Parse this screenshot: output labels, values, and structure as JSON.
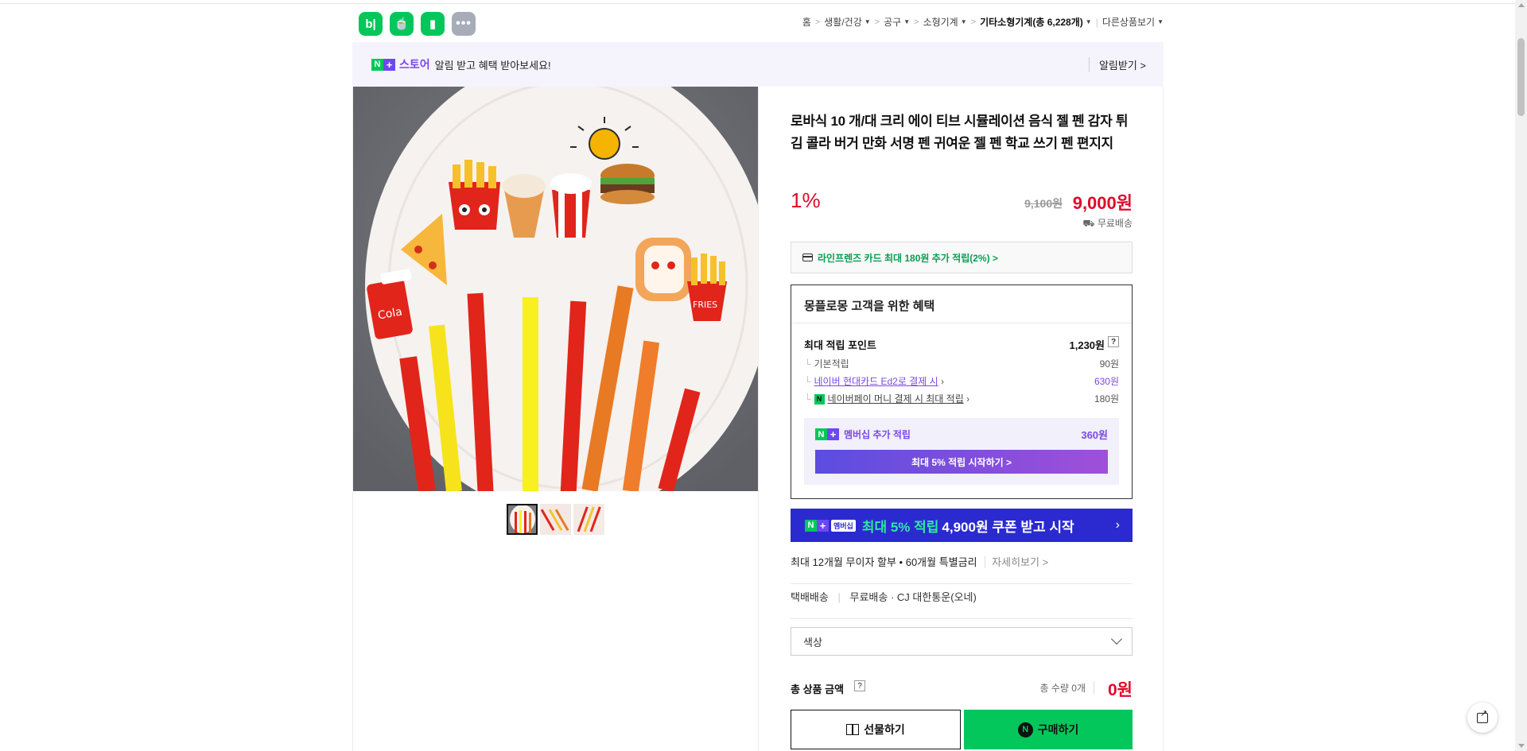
{
  "header": {
    "apps": [
      {
        "icon": "blog-icon",
        "label": "b|"
      },
      {
        "icon": "cafe-icon",
        "label": "🍵"
      },
      {
        "icon": "bookmark-icon",
        "label": "▮"
      },
      {
        "icon": "more-icon",
        "label": "•••"
      }
    ],
    "breadcrumb": {
      "home": "홈",
      "c1": "생활/건강",
      "c2": "공구",
      "c3": "소형기계",
      "c4": "기타소형기계(총 6,228개)",
      "other": "다른상품보기"
    }
  },
  "notice": {
    "store": "스토어",
    "message": "알림 받고 혜택 받아보세요!",
    "alarm": "알림받기 >"
  },
  "product": {
    "title": "로바식 10 개/대 크리 에이 티브 시뮬레이션 음식 젤 펜 감자 튀김 콜라 버거 만화 서명 펜 귀여운 젤 펜 학교 쓰기 펜 편지지",
    "discount": "1%",
    "original_price": "9,100원",
    "price": "9,000원",
    "shipping": "무료배송"
  },
  "card_benefit": "라인프렌즈 카드 최대 180원 추가 적립(2%) >",
  "benefit_box": {
    "heading": "몽플로몽 고객을 위한 혜택",
    "max_points_label": "최대 적립 포인트",
    "max_points_value": "1,230원",
    "basic_label": "기본적립",
    "basic_value": "90원",
    "card_label": "네이버 현대카드 Ed2로 결제 시",
    "card_value": "630원",
    "pay_label": "네이버페이 머니 결제 시 최대 적립",
    "pay_value": "180원",
    "member_label": "멤버십 추가 적립",
    "member_value": "360원",
    "member_button": "최대 5% 적립 시작하기 >"
  },
  "banner": {
    "badge": "멤버십",
    "green": "최대 5% 적립",
    "text": "4,900원 쿠폰 받고 시작",
    "arrow": "›"
  },
  "installment": {
    "text": "최대 12개월 무이자 할부 • 60개월 특별금리",
    "more": "자세히보기 >"
  },
  "delivery": {
    "type": "택배배송",
    "free": "무료배송",
    "carrier": "· CJ 대한통운(오네)"
  },
  "option_select": "색상",
  "total": {
    "label": "총 상품 금액",
    "qty": "총 수량 0개",
    "sum": "0원"
  },
  "buttons": {
    "gift": "선물하기",
    "buy": "구매하기"
  },
  "colors": {
    "naver_green": "#03c75a",
    "sale_red": "#e0082a",
    "membership_purple": "#7b48e8",
    "banner_blue": "#2b2ad0"
  }
}
